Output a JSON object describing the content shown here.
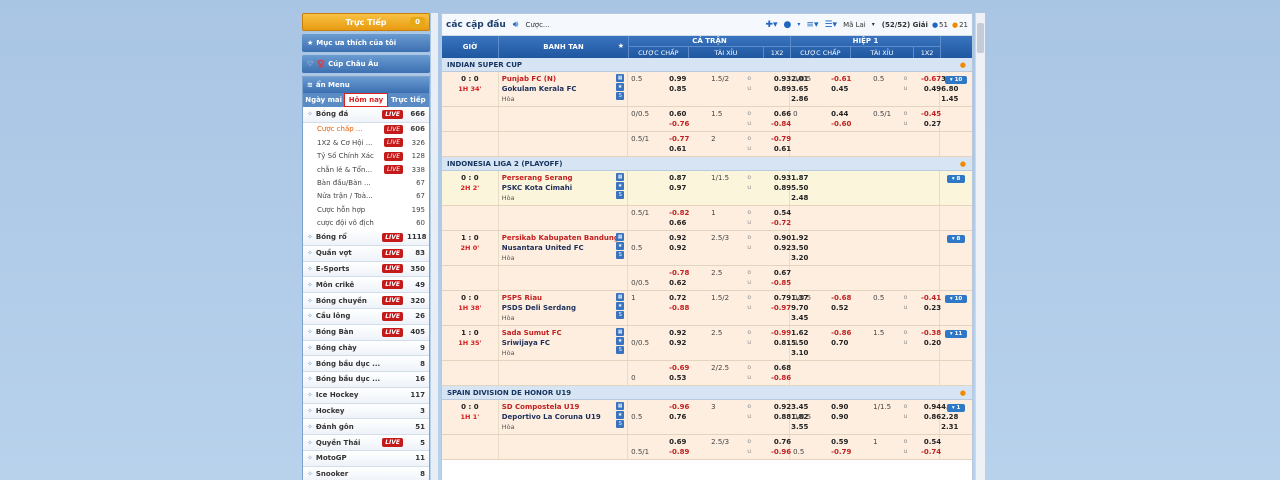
{
  "left": {
    "live_btn": "Trực Tiếp",
    "live_count": "0",
    "favorites": "Mục ưa thích của tôi",
    "euro": "Cúp Châu Âu",
    "menu_title": "ẩn Menu",
    "tabs": [
      "Ngày mai",
      "Hôm nay",
      "Trực tiếp"
    ],
    "sports_top": [
      {
        "name": "Bóng đá",
        "live": true,
        "num": "666"
      }
    ],
    "subs": [
      {
        "name": "Cược chấp ...",
        "live": true,
        "num": "606",
        "sel": true
      },
      {
        "name": "1X2 & Cơ Hội ...",
        "live": true,
        "num": "326"
      },
      {
        "name": "Tỷ Số Chính Xác",
        "live": true,
        "num": "128"
      },
      {
        "name": "chẵn lẻ & Tổn...",
        "live": true,
        "num": "338"
      },
      {
        "name": "Bàn đầu/Bàn ...",
        "live": false,
        "num": "67"
      },
      {
        "name": "Nửa trận / Toà...",
        "live": false,
        "num": "67"
      },
      {
        "name": "Cược hỗn hợp",
        "live": false,
        "num": "195"
      },
      {
        "name": "cược đội vô địch",
        "live": false,
        "num": "60"
      }
    ],
    "sports": [
      {
        "name": "Bóng rổ",
        "live": true,
        "num": "1118"
      },
      {
        "name": "Quần vợt",
        "live": true,
        "num": "83"
      },
      {
        "name": "E-Sports",
        "live": true,
        "num": "350"
      },
      {
        "name": "Môn crikê",
        "live": true,
        "num": "49"
      },
      {
        "name": "Bóng chuyền",
        "live": true,
        "num": "320"
      },
      {
        "name": "Cầu lông",
        "live": true,
        "num": "26"
      },
      {
        "name": "Bóng Bàn",
        "live": true,
        "num": "405"
      },
      {
        "name": "Bóng chày",
        "live": false,
        "num": "9"
      },
      {
        "name": "Bóng bầu dục ...",
        "live": false,
        "num": "8"
      },
      {
        "name": "Bóng bầu dục ...",
        "live": false,
        "num": "16"
      },
      {
        "name": "Ice Hockey",
        "live": false,
        "num": "117"
      },
      {
        "name": "Hockey",
        "live": false,
        "num": "3"
      },
      {
        "name": "Đánh gôn",
        "live": false,
        "num": "51"
      },
      {
        "name": "Quyền Thái",
        "live": true,
        "num": "5"
      },
      {
        "name": "MotoGP",
        "live": false,
        "num": "11"
      },
      {
        "name": "Snooker",
        "live": false,
        "num": "8"
      }
    ],
    "live_label": "LIVE"
  },
  "toolbar": {
    "title": "các cặp đấu",
    "bet": "Cược...",
    "region": "Mã Lai",
    "giai": "(52/52) Giải",
    "c1": "51",
    "c2": "21"
  },
  "header": {
    "time": "GIỜ",
    "team": "BANH TAN",
    "full": "CẢ TRẬN",
    "half": "HIỆP 1",
    "hc": "CƯỢC CHẤP",
    "ou": "TÀI XỈU",
    "x12": "1X2"
  },
  "leagues": [
    {
      "name": "INDIAN SUPER CUP",
      "matches": [
        {
          "score": "0 : 0",
          "time": "1H 34'",
          "home": "Punjab FC (N)",
          "away": "Gokulam Kerala FC",
          "draw": "Hòa",
          "more": "▾ 10",
          "lines": [
            {
              "hcl": "0.5",
              "hh": "0.99",
              "oul": "1.5/2",
              "ou1": "0.93",
              "x": "2.01",
              "h_hcl": "0/0.5",
              "h_hh": "-0.61",
              "h_oul": "0.5",
              "h_ou1": "-0.67",
              "h_x": "3.55"
            },
            {
              "hcl": "",
              "hh": "0.85",
              "oul": "",
              "ou1": "0.89",
              "x": "3.65",
              "h_hcl": "",
              "h_hh": "0.45",
              "h_oul": "",
              "h_ou1": "0.49",
              "h_x": "6.80"
            },
            {
              "hcl": "",
              "hh": "",
              "oul": "",
              "ou1": "",
              "x": "2.86",
              "h_hcl": "",
              "h_hh": "",
              "h_oul": "",
              "h_ou1": "",
              "h_x": "1.45"
            }
          ]
        },
        {
          "extra": true,
          "lines": [
            {
              "hcl": "0/0.5",
              "hh": "0.60",
              "oul": "1.5",
              "ou1": "0.66",
              "x": "",
              "h_hcl": "0",
              "h_hh": "0.44",
              "h_oul": "0.5/1",
              "h_ou1": "-0.45",
              "h_x": ""
            },
            {
              "hcl": "",
              "hh": "-0.76",
              "oul": "",
              "ou1": "-0.84",
              "x": "",
              "h_hcl": "",
              "h_hh": "-0.60",
              "h_oul": "",
              "h_ou1": "0.27",
              "h_x": ""
            }
          ]
        },
        {
          "extra": true,
          "lines": [
            {
              "hcl": "0.5/1",
              "hh": "-0.77",
              "oul": "2",
              "ou1": "-0.79",
              "x": "",
              "h_hcl": "",
              "h_hh": "",
              "h_oul": "",
              "h_ou1": "",
              "h_x": ""
            },
            {
              "hcl": "",
              "hh": "0.61",
              "oul": "",
              "ou1": "0.61",
              "x": "",
              "h_hcl": "",
              "h_hh": "",
              "h_oul": "",
              "h_ou1": "",
              "h_x": ""
            }
          ]
        }
      ]
    },
    {
      "name": "INDONESIA LIGA 2 (PLAYOFF)",
      "matches": [
        {
          "alt": true,
          "score": "0 : 0",
          "time": "2H 2'",
          "home": "Perserang Serang",
          "away": "PSKC Kota Cimahi",
          "draw": "Hòa",
          "more": "▾ 8",
          "lines": [
            {
              "hcl": "",
              "hh": "0.87",
              "oul": "1/1.5",
              "ou1": "0.93",
              "x": "1.87"
            },
            {
              "hcl": "",
              "hh": "0.97",
              "oul": "",
              "ou1": "0.89",
              "x": "5.50"
            },
            {
              "hcl": "",
              "hh": "",
              "oul": "",
              "ou1": "",
              "x": "2.48"
            }
          ]
        },
        {
          "extra": true,
          "lines": [
            {
              "hcl": "0.5/1",
              "hh": "-0.82",
              "oul": "1",
              "ou1": "0.54",
              "x": ""
            },
            {
              "hcl": "",
              "hh": "0.66",
              "oul": "",
              "ou1": "-0.72",
              "x": ""
            }
          ]
        },
        {
          "score": "1 : 0",
          "time": "2H 0'",
          "home": "Persikab Kabupaten Bandung",
          "away": "Nusantara United FC",
          "draw": "Hòa",
          "more": "▾ 8",
          "lines": [
            {
              "hcl": "",
              "hh": "0.92",
              "oul": "2.5/3",
              "ou1": "0.90",
              "x": "1.92"
            },
            {
              "hcl": "0.5",
              "hh": "0.92",
              "oul": "",
              "ou1": "0.92",
              "x": "3.50"
            },
            {
              "hcl": "",
              "hh": "",
              "oul": "",
              "ou1": "",
              "x": "3.20"
            }
          ]
        },
        {
          "extra": true,
          "lines": [
            {
              "hcl": "",
              "hh": "-0.78",
              "oul": "2.5",
              "ou1": "0.67",
              "x": ""
            },
            {
              "hcl": "0/0.5",
              "hh": "0.62",
              "oul": "",
              "ou1": "-0.85",
              "x": ""
            }
          ]
        },
        {
          "score": "0 : 0",
          "time": "1H 38'",
          "home": "PSPS Riau",
          "away": "PSDS Deli Serdang",
          "draw": "Hòa",
          "more": "▾ 10",
          "lines": [
            {
              "hcl": "1",
              "hh": "0.72",
              "oul": "1.5/2",
              "ou1": "0.79",
              "x": "1.37",
              "h_hcl": "0/0.5",
              "h_hh": "-0.68",
              "h_oul": "0.5",
              "h_ou1": "-0.41",
              "h_x": ""
            },
            {
              "hcl": "",
              "hh": "-0.88",
              "oul": "",
              "ou1": "-0.97",
              "x": "9.70",
              "h_hcl": "",
              "h_hh": "0.52",
              "h_oul": "",
              "h_ou1": "0.23",
              "h_x": ""
            },
            {
              "hcl": "",
              "hh": "",
              "oul": "",
              "ou1": "",
              "x": "3.45"
            }
          ]
        },
        {
          "score": "1 : 0",
          "time": "1H 35'",
          "home": "Sada Sumut FC",
          "away": "Sriwijaya FC",
          "draw": "Hòa",
          "more": "▾ 11",
          "lines": [
            {
              "hcl": "",
              "hh": "0.92",
              "oul": "2.5",
              "ou1": "-0.99",
              "x": "1.62",
              "h_hcl": "",
              "h_hh": "-0.86",
              "h_oul": "1.5",
              "h_ou1": "-0.38",
              "h_x": ""
            },
            {
              "hcl": "0/0.5",
              "hh": "0.92",
              "oul": "",
              "ou1": "0.81",
              "x": "5.50",
              "h_hcl": "0",
              "h_hh": "0.70",
              "h_oul": "",
              "h_ou1": "0.20",
              "h_x": ""
            },
            {
              "hcl": "",
              "hh": "",
              "oul": "",
              "ou1": "",
              "x": "3.10"
            }
          ]
        },
        {
          "extra": true,
          "lines": [
            {
              "hcl": "",
              "hh": "-0.69",
              "oul": "2/2.5",
              "ou1": "0.68",
              "x": ""
            },
            {
              "hcl": "0",
              "hh": "0.53",
              "oul": "",
              "ou1": "-0.86",
              "x": ""
            }
          ]
        }
      ]
    },
    {
      "name": "SPAIN DIVISION DE HONOR U19",
      "matches": [
        {
          "score": "0 : 0",
          "time": "1H 1'",
          "home": "SD Compostela U19",
          "away": "Deportivo La Coruna U19",
          "draw": "Hòa",
          "more": "▾ 1",
          "lines": [
            {
              "hcl": "",
              "hh": "-0.96",
              "oul": "3",
              "ou1": "0.92",
              "x": "3.45",
              "h_hcl": "",
              "h_hh": "0.90",
              "h_oul": "1/1.5",
              "h_ou1": "0.94",
              "h_x": "4.00"
            },
            {
              "hcl": "0.5",
              "hh": "0.76",
              "oul": "",
              "ou1": "0.88",
              "x": "1.82",
              "h_hcl": "0/0.5",
              "h_hh": "0.90",
              "h_oul": "",
              "h_ou1": "0.86",
              "h_x": "2.28"
            },
            {
              "hcl": "",
              "hh": "",
              "oul": "",
              "ou1": "",
              "x": "3.55",
              "h_hcl": "",
              "h_hh": "",
              "h_oul": "",
              "h_ou1": "",
              "h_x": "2.31"
            }
          ]
        },
        {
          "extra": true,
          "lines": [
            {
              "hcl": "",
              "hh": "0.69",
              "oul": "2.5/3",
              "ou1": "0.76",
              "x": "",
              "h_hcl": "",
              "h_hh": "0.59",
              "h_oul": "1",
              "h_ou1": "0.54",
              "h_x": ""
            },
            {
              "hcl": "0.5/1",
              "hh": "-0.89",
              "oul": "",
              "ou1": "-0.96",
              "x": "",
              "h_hcl": "0.5",
              "h_hh": "-0.79",
              "h_oul": "",
              "h_ou1": "-0.74",
              "h_x": ""
            }
          ]
        }
      ]
    }
  ]
}
